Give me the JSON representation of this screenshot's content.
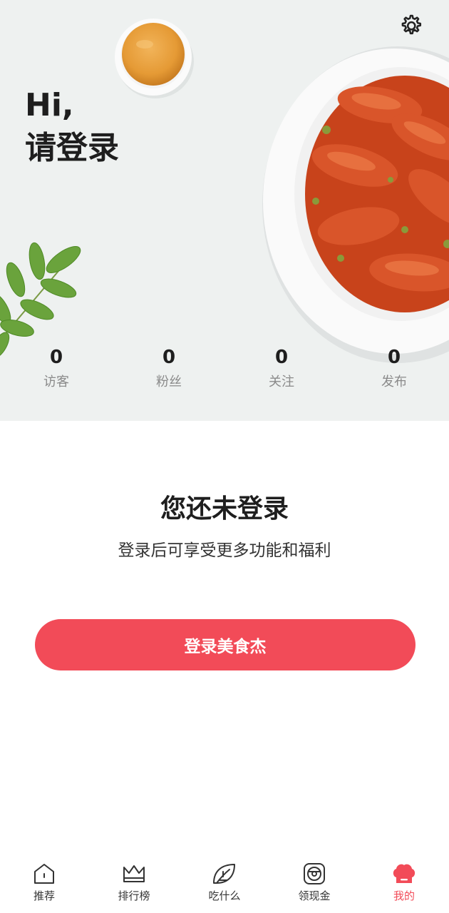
{
  "header": {
    "greeting_line1": "Hi,",
    "greeting_line2": "请登录"
  },
  "stats": [
    {
      "value": "0",
      "label": "访客"
    },
    {
      "value": "0",
      "label": "粉丝"
    },
    {
      "value": "0",
      "label": "关注"
    },
    {
      "value": "0",
      "label": "发布"
    }
  ],
  "login": {
    "title": "您还未登录",
    "subtitle": "登录后可享受更多功能和福利",
    "button": "登录美食杰"
  },
  "tabbar": [
    {
      "label": "推荐",
      "icon": "home-icon"
    },
    {
      "label": "排行榜",
      "icon": "crown-icon"
    },
    {
      "label": "吃什么",
      "icon": "leaf-icon"
    },
    {
      "label": "领现金",
      "icon": "coin-icon"
    },
    {
      "label": "我的",
      "icon": "chef-hat-icon",
      "active": true
    }
  ],
  "colors": {
    "accent": "#f24b58",
    "hero_bg": "#eef1f0",
    "muted_text": "#8a8a8a"
  }
}
